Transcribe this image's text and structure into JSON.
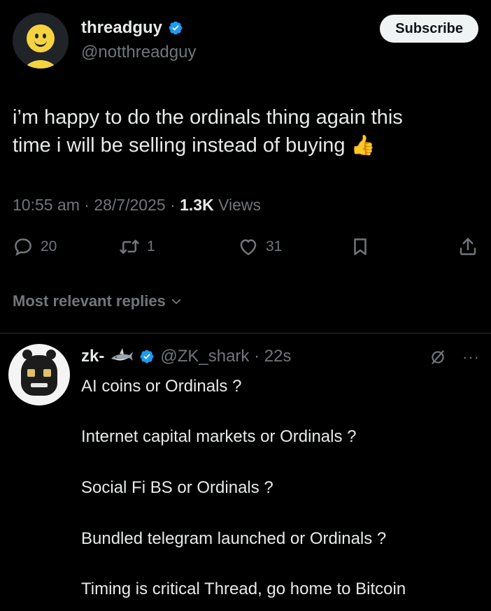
{
  "post": {
    "author": {
      "display_name": "threadguy",
      "handle": "@notthreadguy",
      "verified": true,
      "avatar_icon": "smiley-icon"
    },
    "subscribe_label": "Subscribe",
    "text_lines": [
      "i’m happy to do the ordinals thing again this",
      "time i will be selling instead of buying"
    ],
    "text_emoji": "👍",
    "timestamp": "10:55 am · 28/7/2025 · ",
    "views_count": "1.3K",
    "views_label": " Views",
    "actions": {
      "replies": "20",
      "reposts": "1",
      "likes": "31"
    }
  },
  "replies_sort": {
    "label": "Most relevant replies"
  },
  "reply": {
    "display_name": "zk-",
    "handle_time": "@ZK_shark · 22s",
    "verified": true,
    "more_label": "···",
    "text_lines": [
      "AI coins or Ordinals ?",
      "Internet capital markets or Ordinals ?",
      "Social Fi BS or Ordinals ?",
      "Bundled telegram launched or Ordinals ?",
      "Timing is critical Thread, go home to Bitcoin"
    ]
  },
  "colors": {
    "background": "#000000",
    "text_primary": "#e7e9ea",
    "text_secondary": "#71767b",
    "verified_blue": "#1d9bf0",
    "button_bg": "#eff3f4"
  }
}
